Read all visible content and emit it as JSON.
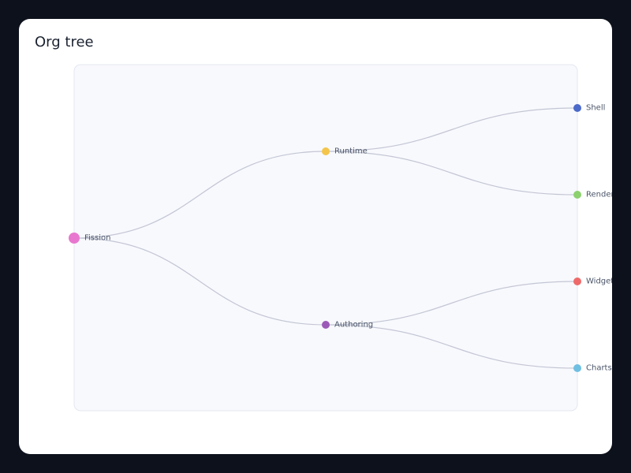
{
  "title": "Org tree",
  "colors": {
    "page_background": "#0d111b",
    "card_background": "#ffffff",
    "panel_fill": "#f8f9fd",
    "panel_border": "#e3e7f1",
    "link_stroke": "#c3c6d4",
    "label_text": "#4b5568"
  },
  "tree": {
    "name": "Fission",
    "color": "#e878cf",
    "children": [
      {
        "name": "Runtime",
        "color": "#f3c54a",
        "children": [
          {
            "name": "Shell",
            "color": "#4b6ac9"
          },
          {
            "name": "Renderer",
            "color": "#8cd16e"
          }
        ]
      },
      {
        "name": "Authoring",
        "color": "#9b5ab8",
        "children": [
          {
            "name": "Widgets",
            "color": "#ee6a6a"
          },
          {
            "name": "Charts",
            "color": "#6fbfe2"
          }
        ]
      }
    ]
  }
}
